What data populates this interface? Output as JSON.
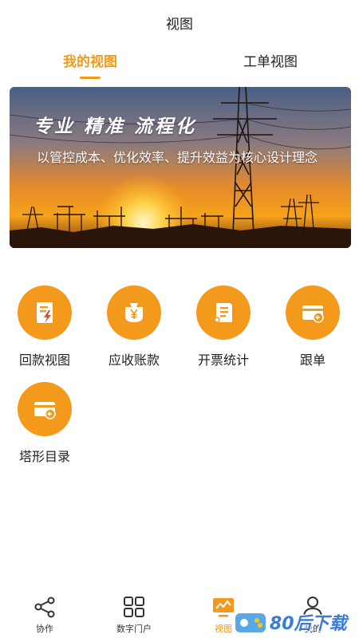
{
  "header": {
    "title": "视图"
  },
  "tabs": [
    {
      "label": "我的视图",
      "active": true
    },
    {
      "label": "工单视图",
      "active": false
    }
  ],
  "banner": {
    "headline": "专业 精准 流程化",
    "subtitle": "以管控成本、优化效率、提升效益为核心设计理念"
  },
  "grid": [
    {
      "label": "回款视图",
      "icon": "document-lightning-icon"
    },
    {
      "label": "应收账款",
      "icon": "yen-bag-icon"
    },
    {
      "label": "开票统计",
      "icon": "scroll-receipt-icon"
    },
    {
      "label": "跟单",
      "icon": "card-arrow-icon"
    },
    {
      "label": "塔形目录",
      "icon": "card-arrow-icon"
    }
  ],
  "bottom_nav": [
    {
      "label": "协作",
      "icon": "share-nodes-icon",
      "active": false
    },
    {
      "label": "数字门户",
      "icon": "grid-apps-icon",
      "active": false
    },
    {
      "label": "视图",
      "icon": "monitor-chart-icon",
      "active": true
    },
    {
      "label": "我的",
      "icon": "person-icon",
      "active": false
    }
  ],
  "watermark": {
    "text": "80后下载"
  },
  "colors": {
    "accent": "#f39a1d",
    "text": "#222222",
    "watermark": "#3a7bd5"
  }
}
